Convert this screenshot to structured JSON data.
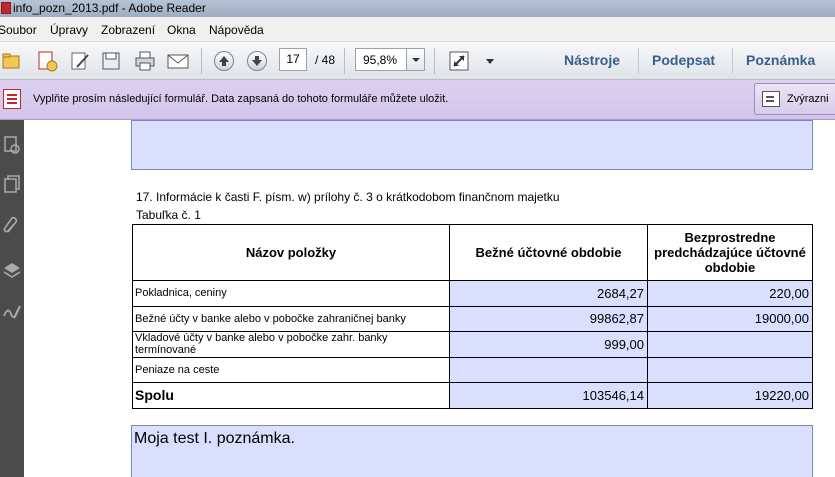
{
  "window": {
    "title": "info_pozn_2013.pdf - Adobe Reader"
  },
  "menu": [
    "Soubor",
    "Úpravy",
    "Zobrazení",
    "Okna",
    "Nápověda"
  ],
  "toolbar": {
    "page_current": "17",
    "page_total": "/ 48",
    "zoom": "95,8%",
    "tools_label": "Nástroje",
    "sign_label": "Podepsat",
    "comment_label": "Poznámka"
  },
  "form_bar": {
    "message": "Vyplňte prosím následující formulář. Data zapsaná do tohoto formuláře můžete uložit.",
    "highlight_label": "Zvýrazni"
  },
  "document": {
    "section_title": "17. Informácie k časti F. písm. w) prílohy č. 3 o krátkodobom finančnom majetku",
    "table_caption": "Tabuľka č. 1",
    "table": {
      "headers": [
        "Názov položky",
        "Bežné účtovné obdobie",
        "Bezprostredne predchádzajúce účtovné obdobie"
      ],
      "rows": [
        {
          "label": "Pokladnica, ceniny",
          "current": "2684,27",
          "previous": "220,00"
        },
        {
          "label": "Bežné účty v banke alebo v pobočke zahraničnej banky",
          "current": "99862,87",
          "previous": "19000,00"
        },
        {
          "label": "Vkladové účty v banke alebo v pobočke zahr. banky termínované",
          "current": "999,00",
          "previous": ""
        },
        {
          "label": "Peniaze na ceste",
          "current": "",
          "previous": ""
        }
      ],
      "total": {
        "label": "Spolu",
        "current": "103546,14",
        "previous": "19220,00"
      }
    },
    "note_text": "Moja test I. poznámka."
  }
}
